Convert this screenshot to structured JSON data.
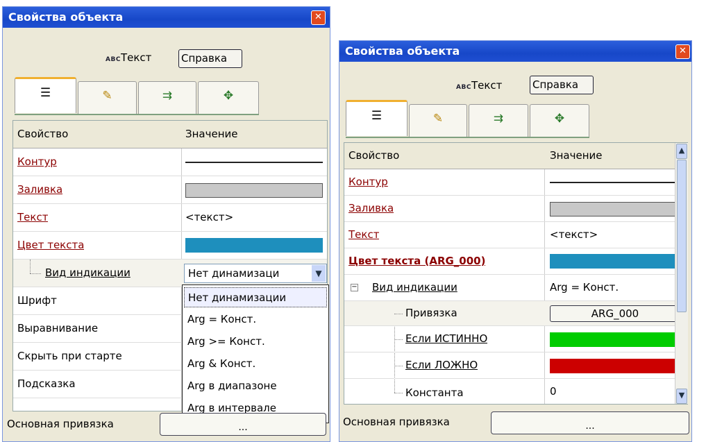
{
  "left": {
    "title": "Свойства объекта",
    "close": "✕",
    "abc": "ABC",
    "object_type": "Текст",
    "help": "Справка",
    "columns": {
      "property": "Свойство",
      "value": "Значение"
    },
    "rows": {
      "contour": "Контур",
      "fill": "Заливка",
      "text": "Текст",
      "text_value": "<текст>",
      "text_color": "Цвет текста",
      "indication": "Вид индикации",
      "font": "Шрифт",
      "align": "Выравнивание",
      "hide": "Скрыть при старте",
      "hint": "Подсказка"
    },
    "combo_value": "Нет динамизаци",
    "dropdown": [
      "Нет динамизации",
      "Arg = Конст.",
      "Arg >= Конст.",
      "Arg & Конст.",
      "Arg в диапазоне",
      "Arg в интервале"
    ],
    "footer_label": "Основная привязка",
    "footer_button": "..."
  },
  "right": {
    "title": "Свойства объекта",
    "close": "✕",
    "abc": "ABC",
    "object_type": "Текст",
    "help": "Справка",
    "columns": {
      "property": "Свойство",
      "value": "Значение"
    },
    "rows": {
      "contour": "Контур",
      "fill": "Заливка",
      "text": "Текст",
      "text_value": "<текст>",
      "text_color": "Цвет текста (ARG_000)",
      "indication": "Вид индикации",
      "indication_value": "Arg = Конст.",
      "binding": "Привязка",
      "binding_value": "ARG_000",
      "if_true": "Если ИСТИННО",
      "if_false": "Если ЛОЖНО",
      "constant": "Константа",
      "constant_value": "0"
    },
    "footer_label": "Основная привязка",
    "footer_button": "..."
  },
  "tab_icons": [
    "list-icon",
    "paint-icon",
    "link-icon",
    "move-icon"
  ],
  "colors": {
    "text_color_swatch": "#1e8fbd",
    "fill_swatch": "#c8c8c8",
    "true_color": "#00cc00",
    "false_color": "#cc0000"
  }
}
